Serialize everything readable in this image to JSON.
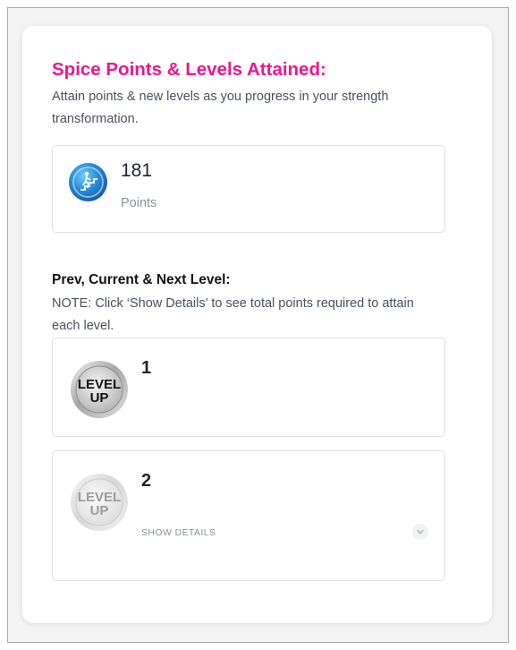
{
  "header": {
    "title": "Spice Points & Levels Attained:",
    "subtitle": "Attain points & new levels as you progress in your strength transformation."
  },
  "points": {
    "value": "181",
    "label": "Points",
    "icon": "stair-climber-icon"
  },
  "levels_section": {
    "title": "Prev, Current & Next Level:",
    "note": "NOTE: Click ‘Show Details’ to see total points required to attain each level."
  },
  "levels": [
    {
      "number": "1",
      "badge_text_line1": "LEVEL",
      "badge_text_line2": "UP",
      "icon": "level-up-badge-icon"
    },
    {
      "number": "2",
      "badge_text_line1": "LEVEL",
      "badge_text_line2": "UP",
      "icon": "level-up-badge-icon",
      "show_details_label": "SHOW DETAILS"
    }
  ],
  "colors": {
    "accent": "#ee1590",
    "body_text": "#4a5160",
    "muted_text": "#8b919c"
  }
}
